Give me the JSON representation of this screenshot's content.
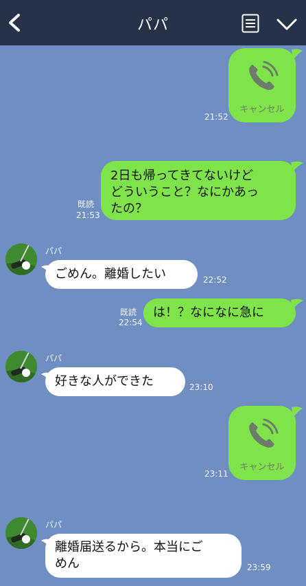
{
  "header": {
    "title": "パパ"
  },
  "messages": {
    "m1": {
      "label": "キャンセル",
      "time": "21:52"
    },
    "m2": {
      "line1": "2日も帰ってきてないけど",
      "line2": "どういうこと？なにかあっ",
      "line3": "たの？",
      "read": "既読",
      "time": "21:53"
    },
    "m3": {
      "sender": "パパ",
      "text": "ごめん。離婚したい",
      "time": "22:52"
    },
    "m4": {
      "text": "は！？なになに急に",
      "read": "既読",
      "time": "22:54"
    },
    "m5": {
      "sender": "パパ",
      "text": "好きな人ができた",
      "time": "23:10"
    },
    "m6": {
      "label": "キャンセル",
      "time": "23:11"
    },
    "m7": {
      "sender": "パパ",
      "line1": "離婚届送るから。本当にご",
      "line2": "めん",
      "time": "23:59"
    }
  },
  "icons": {
    "back": "chevron-left-icon",
    "menu": "note-list-icon",
    "down": "chevron-down-icon",
    "call": "phone-missed-icon",
    "avatar": "golf-ball-avatar"
  },
  "colors": {
    "header_bg": "#263248",
    "chat_bg": "#6f8fc2",
    "own_bubble": "#7fe34a",
    "other_bubble": "#ffffff"
  }
}
